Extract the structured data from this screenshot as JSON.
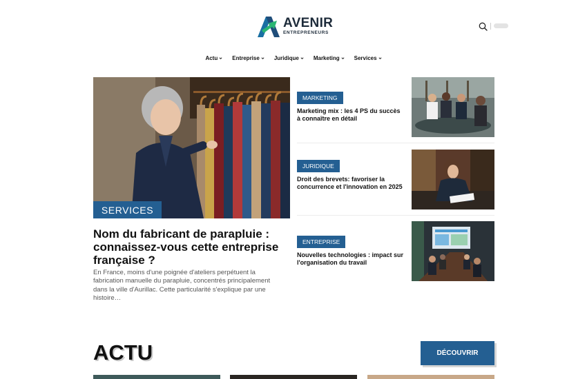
{
  "header": {
    "logo_main": "AVENIR",
    "logo_sub": "ENTREPRENEURS",
    "search_icon": "search-icon",
    "accent_color": "#245f92"
  },
  "nav": {
    "items": [
      {
        "label": "Actu"
      },
      {
        "label": "Entreprise"
      },
      {
        "label": "Juridique"
      },
      {
        "label": "Marketing"
      },
      {
        "label": "Services"
      }
    ]
  },
  "featured": {
    "category": "SERVICES",
    "title": "Nom du fabricant de parapluie : connaissez-vous cette entreprise française ?",
    "excerpt": "En France, moins d'une poignée d'ateliers perpétuent la fabrication manuelle du parapluie, concentrés principalement dans la ville d'Aurillac. Cette particularité s'explique par une histoire…"
  },
  "side_articles": [
    {
      "category": "MARKETING",
      "title": "Marketing mix : les 4 PS du succès à connaître en détail"
    },
    {
      "category": "JURIDIQUE",
      "title": "Droit des brevets: favoriser la concurrence et l'innovation en 2025"
    },
    {
      "category": "ENTREPRISE",
      "title": "Nouvelles technologies : impact sur l'organisation du travail"
    }
  ],
  "actu": {
    "title": "ACTU",
    "button": "DÉCOUVRIR"
  }
}
